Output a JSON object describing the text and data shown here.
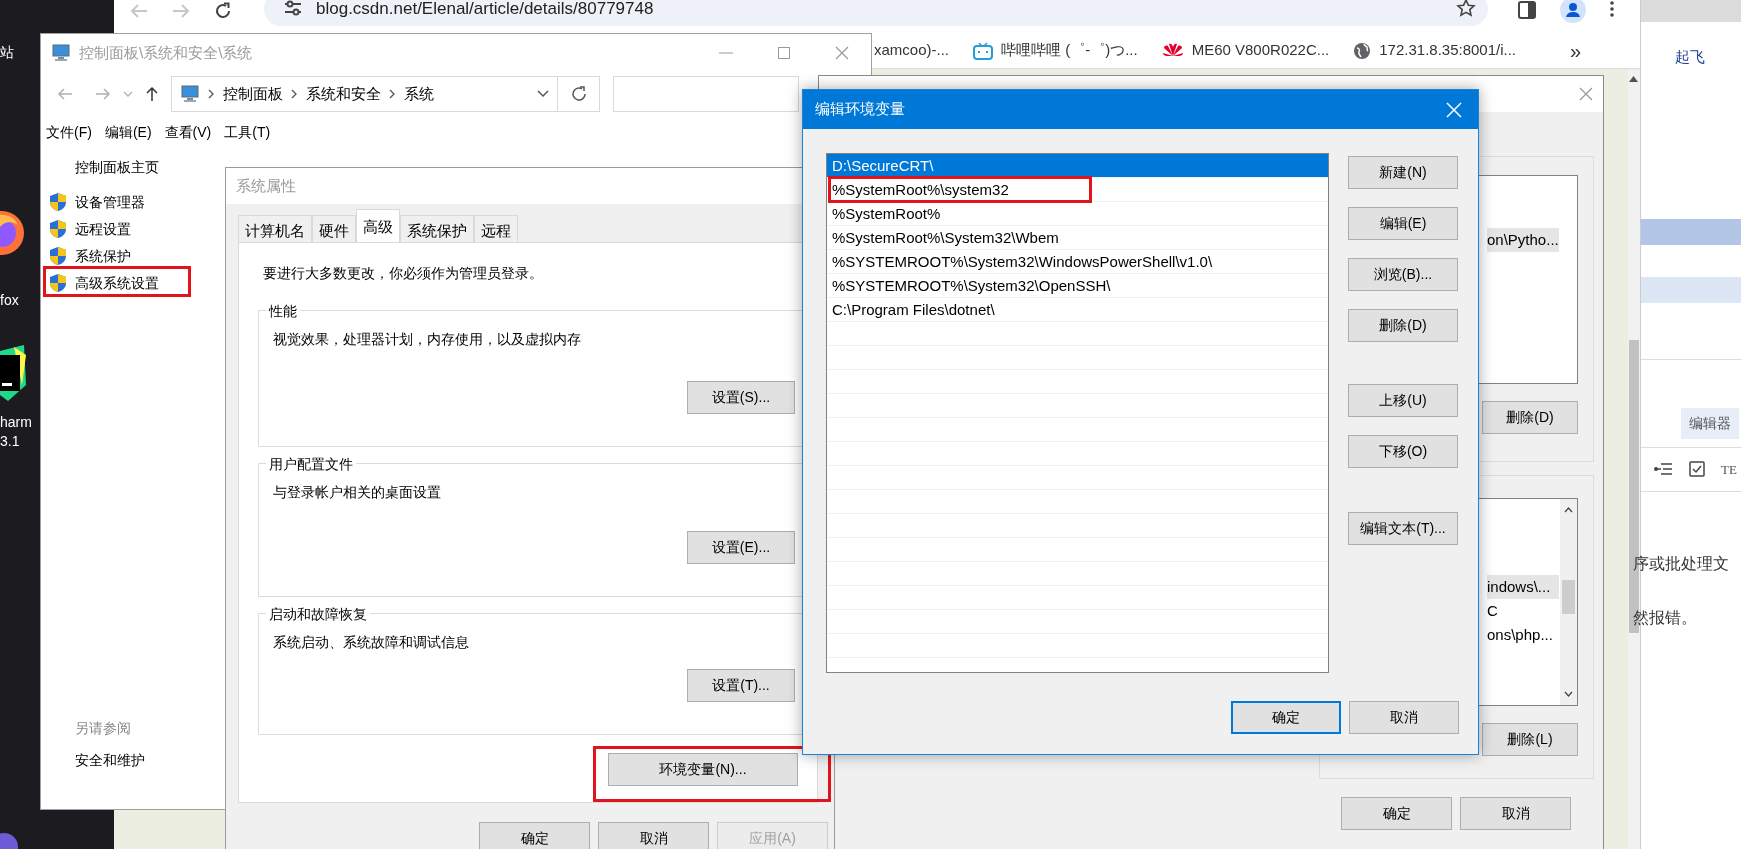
{
  "desktop": {
    "bin_label": "站",
    "firefox_label": "fox",
    "pycharm_label_lines": [
      "harm",
      "3.1"
    ]
  },
  "browser": {
    "url": "blog.csdn.net/Elenal/article/details/80779748",
    "bookmarks": [
      {
        "label": "xamcoo)-...",
        "kind": "hidden"
      },
      {
        "label": "哔哩哔哩 (゜-゜)つ...",
        "kind": "bilibili"
      },
      {
        "label": "ME60 V800R022C...",
        "kind": "huawei"
      },
      {
        "label": "172.31.8.35:8001/i...",
        "kind": "globe"
      }
    ],
    "overflow": "»"
  },
  "side_page": {
    "header": "起飞",
    "pill": "编辑器",
    "tex_label": "TE",
    "lines": [
      "序或批处理文",
      "然报错。"
    ]
  },
  "control_panel": {
    "title": "控制面板\\系统和安全\\系统",
    "breadcrumb": [
      "控制面板",
      "系统和安全",
      "系统"
    ],
    "menu": [
      "文件(F)",
      "编辑(E)",
      "查看(V)",
      "工具(T)"
    ],
    "home_link": "控制面板主页",
    "tasks": [
      {
        "label": "设备管理器",
        "highlighted": false
      },
      {
        "label": "远程设置",
        "highlighted": false
      },
      {
        "label": "系统保护",
        "highlighted": false
      },
      {
        "label": "高级系统设置",
        "highlighted": true
      }
    ],
    "see_also_title": "另请参阅",
    "see_also": [
      "安全和维护"
    ]
  },
  "system_properties": {
    "title": "系统属性",
    "tabs": [
      {
        "label": "计算机名",
        "selected": false
      },
      {
        "label": "硬件",
        "selected": false
      },
      {
        "label": "高级",
        "selected": true
      },
      {
        "label": "系统保护",
        "selected": false
      },
      {
        "label": "远程",
        "selected": false
      }
    ],
    "admin_note": "要进行大多数更改，你必须作为管理员登录。",
    "groups": [
      {
        "title": "性能",
        "description": "视觉效果，处理器计划，内存使用，以及虚拟内存",
        "button": "设置(S)..."
      },
      {
        "title": "用户配置文件",
        "description": "与登录帐户相关的桌面设置",
        "button": "设置(E)..."
      },
      {
        "title": "启动和故障恢复",
        "description": "系统启动、系统故障和调试信息",
        "button": "设置(T)..."
      }
    ],
    "env_button": {
      "label": "环境变量(N)...",
      "highlighted": true
    },
    "footer_buttons": [
      {
        "label": "确定",
        "disabled": false
      },
      {
        "label": "取消",
        "disabled": false
      },
      {
        "label": "应用(A)",
        "disabled": true
      }
    ]
  },
  "environment_variables": {
    "user_list": [
      {
        "text": "on\\Pytho...",
        "selected": true
      }
    ],
    "user_delete": "删除(D)",
    "system_list": [
      {
        "text": "indows\\...",
        "selected": true
      },
      {
        "text": "C",
        "selected": false
      },
      {
        "text": "ons\\php...",
        "selected": false
      }
    ],
    "system_delete": "删除(L)",
    "footer_buttons": [
      "确定",
      "取消"
    ]
  },
  "edit_dialog": {
    "title": "编辑环境变量",
    "entries": [
      {
        "text": "D:\\SecureCRT\\",
        "selected": true,
        "highlighted": false
      },
      {
        "text": "%SystemRoot%\\system32",
        "selected": false,
        "highlighted": true
      },
      {
        "text": "%SystemRoot%",
        "selected": false,
        "highlighted": false
      },
      {
        "text": "%SystemRoot%\\System32\\Wbem",
        "selected": false,
        "highlighted": false
      },
      {
        "text": "%SYSTEMROOT%\\System32\\WindowsPowerShell\\v1.0\\",
        "selected": false,
        "highlighted": false
      },
      {
        "text": "%SYSTEMROOT%\\System32\\OpenSSH\\",
        "selected": false,
        "highlighted": false
      },
      {
        "text": "C:\\Program Files\\dotnet\\",
        "selected": false,
        "highlighted": false
      }
    ],
    "button_groups": [
      [
        "新建(N)",
        "编辑(E)",
        "浏览(B)...",
        "删除(D)"
      ],
      [
        "上移(U)",
        "下移(O)"
      ],
      [
        "编辑文本(T)..."
      ]
    ],
    "footer_buttons": [
      {
        "label": "确定",
        "default": true
      },
      {
        "label": "取消",
        "default": false
      }
    ]
  }
}
